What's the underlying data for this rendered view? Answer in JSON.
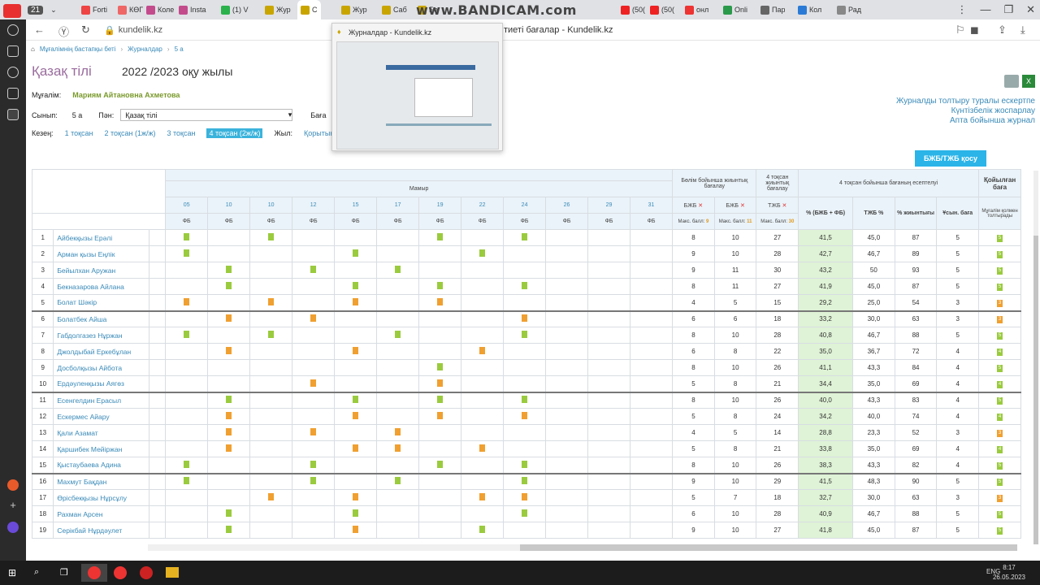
{
  "browser": {
    "counter": "21",
    "tabs": [
      "Forti",
      "КӨГ",
      "Коле",
      "Insta",
      "(1) V",
      "Жур",
      "С",
      "Жур",
      "Саб",
      "Бе",
      "(50(",
      "(50(",
      "онл",
      "Onli",
      "Пар",
      "Кол",
      "Рад"
    ],
    "watermark": "www.BANDICAM.com",
    "url": "kundelik.kz",
    "page_title": "тиеті бағалар - Kundelik.kz"
  },
  "popup": {
    "title": "Журналдар - Kundelik.kz"
  },
  "breadcrumb": [
    "Мұғалімнің бастапқы беті",
    "Журналдар",
    "5 а"
  ],
  "subject_title": "Қазақ тілі",
  "year_title": "2022 /2023 оқу жылы",
  "teacher_label": "Мұғалім:",
  "teacher_name": "Мариям Айтановна Ахметова",
  "class_label": "Сынып:",
  "class_value": "5 а",
  "subject_label": "Пән:",
  "subject_value": "Қазақ тілі",
  "grade_label": "Баға",
  "period_label": "Кезең:",
  "periods": [
    "1 тоқсан",
    "2 тоқсан (1ж/ж)",
    "3 тоқсан",
    "4 тоқсан (2ж/ж)"
  ],
  "year_label": "Жыл:",
  "summary_link": "Қорытынд",
  "right_links": [
    "Журналды толтыру туралы ескертпе",
    "Күнтізбелік жоспарлау",
    "Апта бойынша журнал"
  ],
  "add_button": "БЖБ/ТЖБ қосу",
  "table": {
    "month": "Мамыр",
    "dates": [
      "05",
      "10",
      "10",
      "12",
      "15",
      "17",
      "19",
      "22",
      "24",
      "26",
      "29",
      "31"
    ],
    "fb": "ФБ",
    "section_header": "Бөлім бойынша жиынтық бағалау",
    "term_header": "4 тоқсан жиынтық бағалау",
    "calc_header": "4 тоқсан бойынша бағаның есептелуі",
    "final_header": "Қойылған баға",
    "bjb": "БЖБ",
    "tjb": "ТЖБ",
    "max_label": "Макс. балл:",
    "max_values": [
      "9",
      "11",
      "30"
    ],
    "col_pct": "% (БЖБ + ФБ)",
    "col_tjb": "ТЖБ %",
    "col_total": "% жиынтығы",
    "col_suggest": "Ұсын. баға",
    "col_teacher": "Мұғалім қолмен толтырады",
    "rows": [
      {
        "n": "1",
        "name": "Айбекқызы Ерәлі",
        "marks": [
          [
            "05",
            "g"
          ],
          [
            "10b",
            "g"
          ],
          [
            "19",
            "g"
          ],
          [
            "24",
            "g"
          ]
        ],
        "b1": "8",
        "b2": "10",
        "t": "27",
        "p": "41,5",
        "tp": "45,0",
        "tot": "87",
        "s": "5",
        "f": "5",
        "fc": "g"
      },
      {
        "n": "2",
        "name": "Арман қызы Еңлік",
        "marks": [
          [
            "05",
            "g"
          ],
          [
            "15",
            "g"
          ],
          [
            "22",
            "g"
          ]
        ],
        "b1": "9",
        "b2": "10",
        "t": "28",
        "p": "42,7",
        "tp": "46,7",
        "tot": "89",
        "s": "5",
        "f": "5",
        "fc": "g"
      },
      {
        "n": "3",
        "name": "Бейылхан Аружан",
        "marks": [
          [
            "10",
            "g"
          ],
          [
            "12",
            "g"
          ],
          [
            "17",
            "g"
          ]
        ],
        "b1": "9",
        "b2": "11",
        "t": "30",
        "p": "43,2",
        "tp": "50",
        "tot": "93",
        "s": "5",
        "f": "5",
        "fc": "g"
      },
      {
        "n": "4",
        "name": "Бекназарова Айлана",
        "marks": [
          [
            "10",
            "g"
          ],
          [
            "15",
            "g"
          ],
          [
            "19",
            "g"
          ],
          [
            "24",
            "g"
          ]
        ],
        "b1": "8",
        "b2": "11",
        "t": "27",
        "p": "41,9",
        "tp": "45,0",
        "tot": "87",
        "s": "5",
        "f": "5",
        "fc": "g"
      },
      {
        "n": "5",
        "name": "Болат Шәкір",
        "marks": [
          [
            "05",
            "o"
          ],
          [
            "10b",
            "o"
          ],
          [
            "15",
            "o"
          ],
          [
            "19",
            "o"
          ]
        ],
        "b1": "4",
        "b2": "5",
        "t": "15",
        "p": "29,2",
        "tp": "25,0",
        "tot": "54",
        "s": "3",
        "f": "3",
        "fc": "o"
      },
      {
        "n": "6",
        "name": "Болатбек Айша",
        "marks": [
          [
            "10",
            "o"
          ],
          [
            "12",
            "o"
          ],
          [
            "24",
            "o"
          ]
        ],
        "b1": "6",
        "b2": "6",
        "t": "18",
        "p": "33,2",
        "tp": "30,0",
        "tot": "63",
        "s": "3",
        "f": "3",
        "fc": "o",
        "sep": true
      },
      {
        "n": "7",
        "name": "Габдолгазез Нұржан",
        "marks": [
          [
            "05",
            "g"
          ],
          [
            "10b",
            "g"
          ],
          [
            "17",
            "g"
          ],
          [
            "24",
            "g"
          ]
        ],
        "b1": "8",
        "b2": "10",
        "t": "28",
        "p": "40,8",
        "tp": "46,7",
        "tot": "88",
        "s": "5",
        "f": "5",
        "fc": "g"
      },
      {
        "n": "8",
        "name": "Джолдыбай Еркебұлан",
        "marks": [
          [
            "10",
            "o"
          ],
          [
            "15",
            "o"
          ],
          [
            "22",
            "o"
          ]
        ],
        "b1": "6",
        "b2": "8",
        "t": "22",
        "p": "35,0",
        "tp": "36,7",
        "tot": "72",
        "s": "4",
        "f": "4",
        "fc": "g"
      },
      {
        "n": "9",
        "name": "Досболқызы Айбота",
        "marks": [
          [
            "19",
            "g"
          ]
        ],
        "b1": "8",
        "b2": "10",
        "t": "26",
        "p": "41,1",
        "tp": "43,3",
        "tot": "84",
        "s": "4",
        "f": "5",
        "fc": "g"
      },
      {
        "n": "10",
        "name": "Ердәуленқызы Аягөз",
        "marks": [
          [
            "12",
            "o"
          ],
          [
            "19",
            "o"
          ]
        ],
        "b1": "5",
        "b2": "8",
        "t": "21",
        "p": "34,4",
        "tp": "35,0",
        "tot": "69",
        "s": "4",
        "f": "4",
        "fc": "g"
      },
      {
        "n": "11",
        "name": "Есенгелдин Ерасыл",
        "marks": [
          [
            "10",
            "g"
          ],
          [
            "15",
            "g"
          ],
          [
            "19",
            "g"
          ],
          [
            "24",
            "g"
          ]
        ],
        "b1": "8",
        "b2": "10",
        "t": "26",
        "p": "40,0",
        "tp": "43,3",
        "tot": "83",
        "s": "4",
        "f": "5",
        "fc": "g",
        "sep": true
      },
      {
        "n": "12",
        "name": "Ескермес Айару",
        "marks": [
          [
            "10",
            "o"
          ],
          [
            "15",
            "o"
          ],
          [
            "19",
            "o"
          ],
          [
            "24",
            "o"
          ]
        ],
        "b1": "5",
        "b2": "8",
        "t": "24",
        "p": "34,2",
        "tp": "40,0",
        "tot": "74",
        "s": "4",
        "f": "4",
        "fc": "g"
      },
      {
        "n": "13",
        "name": "Қали Азамат",
        "marks": [
          [
            "10",
            "o"
          ],
          [
            "12",
            "o"
          ],
          [
            "17",
            "o"
          ]
        ],
        "b1": "4",
        "b2": "5",
        "t": "14",
        "p": "28,8",
        "tp": "23,3",
        "tot": "52",
        "s": "3",
        "f": "3",
        "fc": "o"
      },
      {
        "n": "14",
        "name": "Қаршибек Мейіржан",
        "marks": [
          [
            "10",
            "o"
          ],
          [
            "15",
            "o"
          ],
          [
            "17",
            "o"
          ],
          [
            "22",
            "o"
          ]
        ],
        "b1": "5",
        "b2": "8",
        "t": "21",
        "p": "33,8",
        "tp": "35,0",
        "tot": "69",
        "s": "4",
        "f": "4",
        "fc": "g"
      },
      {
        "n": "15",
        "name": "Қыстаубаева Адина",
        "marks": [
          [
            "05",
            "g"
          ],
          [
            "12",
            "g"
          ],
          [
            "19",
            "g"
          ],
          [
            "24",
            "g"
          ]
        ],
        "b1": "8",
        "b2": "10",
        "t": "26",
        "p": "38,3",
        "tp": "43,3",
        "tot": "82",
        "s": "4",
        "f": "5",
        "fc": "g"
      },
      {
        "n": "16",
        "name": "Махмут Бақдан",
        "marks": [
          [
            "05",
            "g"
          ],
          [
            "12",
            "g"
          ],
          [
            "17",
            "g"
          ],
          [
            "24",
            "g"
          ]
        ],
        "b1": "9",
        "b2": "10",
        "t": "29",
        "p": "41,5",
        "tp": "48,3",
        "tot": "90",
        "s": "5",
        "f": "5",
        "fc": "g",
        "sep": true
      },
      {
        "n": "17",
        "name": "Өрісбекқызы Нұрсұлу",
        "marks": [
          [
            "10b",
            "o"
          ],
          [
            "15",
            "o"
          ],
          [
            "22",
            "o"
          ],
          [
            "24",
            "o"
          ]
        ],
        "b1": "5",
        "b2": "7",
        "t": "18",
        "p": "32,7",
        "tp": "30,0",
        "tot": "63",
        "s": "3",
        "f": "3",
        "fc": "o"
      },
      {
        "n": "18",
        "name": "Рахман Арсен",
        "marks": [
          [
            "10",
            "g"
          ],
          [
            "15",
            "g"
          ],
          [
            "24",
            "g"
          ]
        ],
        "b1": "6",
        "b2": "10",
        "t": "28",
        "p": "40,9",
        "tp": "46,7",
        "tot": "88",
        "s": "5",
        "f": "5",
        "fc": "g"
      },
      {
        "n": "19",
        "name": "Серікбай Нұрдәулет",
        "marks": [
          [
            "10",
            "g"
          ],
          [
            "15",
            "o"
          ],
          [
            "22",
            "g"
          ]
        ],
        "b1": "9",
        "b2": "10",
        "t": "27",
        "p": "41,8",
        "tp": "45,0",
        "tot": "87",
        "s": "5",
        "f": "5",
        "fc": "g"
      }
    ]
  },
  "clock": {
    "time": "8:17",
    "date": "26.05.2023",
    "lang": "ENG"
  }
}
